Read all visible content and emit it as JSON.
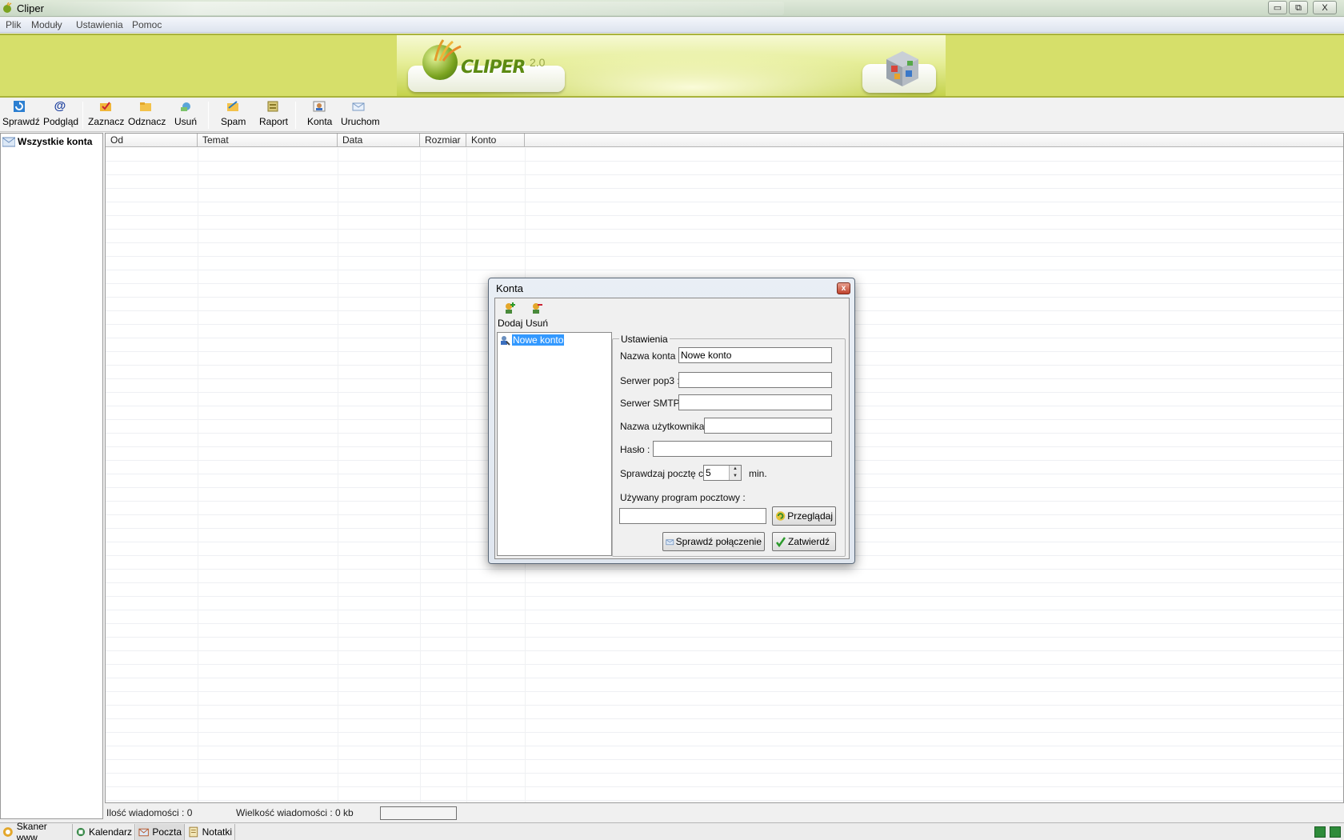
{
  "window": {
    "title": "Cliper",
    "controls": {
      "minimize": "▭",
      "maximize": "⧉",
      "close": "X"
    }
  },
  "menu": [
    "Plik",
    "Moduły",
    "Ustawienia",
    "Pomoc"
  ],
  "banner": {
    "logo_text": "CLIPER",
    "logo_version": "2.0"
  },
  "toolbar": {
    "sprawdz": "Sprawdź",
    "podglad": "Podgląd",
    "zaznacz": "Zaznacz",
    "odznacz": "Odznacz",
    "usun": "Usuń",
    "spam": "Spam",
    "raport": "Raport",
    "konta": "Konta",
    "uruchom": "Uruchom"
  },
  "sidebar": {
    "all_accounts": "Wszystkie konta"
  },
  "grid": {
    "columns": [
      "Od",
      "Temat",
      "Data",
      "Rozmiar",
      "Konto"
    ]
  },
  "status": {
    "count": "Ilość wiadomości : 0",
    "size": "Wielkość wiadomości : 0 kb"
  },
  "bottom_tabs": [
    "Skaner www",
    "Kalendarz",
    "Poczta",
    "Notatki"
  ],
  "active_tab": "Poczta",
  "dialog": {
    "title": "Konta",
    "close": "x",
    "toolbar": {
      "add": "Dodaj",
      "remove": "Usuń"
    },
    "accounts": [
      "Nowe konto"
    ],
    "group_label": "Ustawienia",
    "fields": {
      "account_name": {
        "label": "Nazwa konta :",
        "value": "Nowe konto"
      },
      "pop3": {
        "label": "Serwer pop3 :",
        "value": ""
      },
      "smtp": {
        "label": "Serwer SMTP :",
        "value": ""
      },
      "username": {
        "label": "Nazwa użytkownika :",
        "value": ""
      },
      "password": {
        "label": "Hasło :",
        "value": ""
      },
      "interval": {
        "label": "Sprawdzaj pocztę co :",
        "value": "5",
        "unit": "min."
      },
      "mail_program": {
        "label": "Używany program pocztowy :",
        "value": ""
      }
    },
    "buttons": {
      "browse": "Przeglądaj",
      "test": "Sprawdź połączenie",
      "confirm": "Zatwierdź"
    }
  }
}
